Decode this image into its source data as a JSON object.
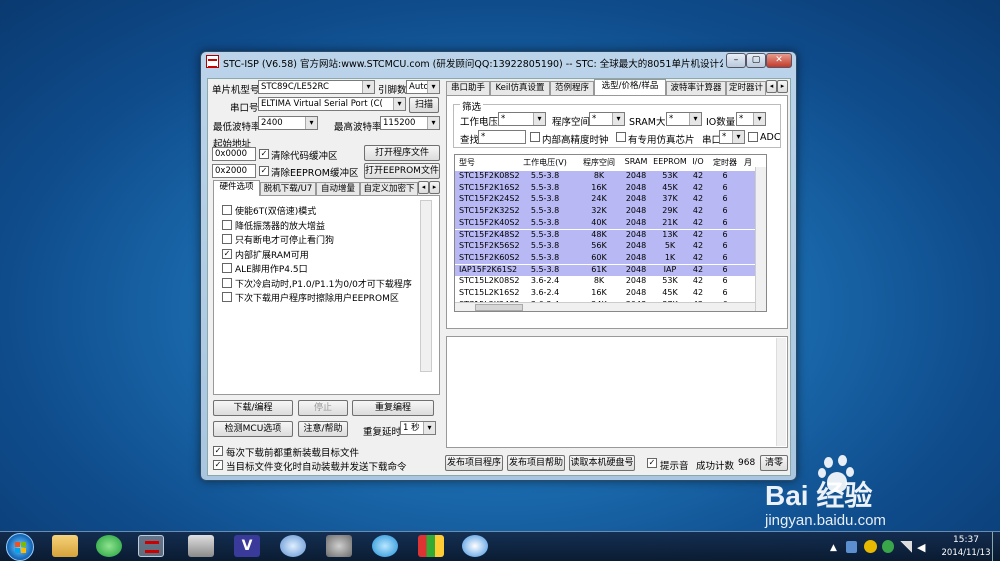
{
  "window": {
    "title": "STC-ISP (V6.58) 官方网站:www.STCMCU.com (研发顾问QQ:13922805190) -- STC: 全球最大的8051单片机设计公司 (我..."
  },
  "left": {
    "mcu_label": "单片机型号",
    "mcu_value": "STC89C/LE52RC",
    "pins_label": "引脚数",
    "pins_value": "Auto",
    "port_label": "串口号",
    "port_value": "ELTIMA Virtual Serial Port (C(",
    "scan": "扫描",
    "minbaud_label": "最低波特率",
    "minbaud_value": "2400",
    "maxbaud_label": "最高波特率",
    "maxbaud_value": "115200",
    "start_label": "起始地址",
    "addr1": "0x0000",
    "clear_code": "清除代码缓冲区",
    "open_prog": "打开程序文件",
    "addr2": "0x2000",
    "clear_eeprom": "清除EEPROM缓冲区",
    "open_eeprom": "打开EEPROM文件",
    "tabs": [
      "硬件选项",
      "脱机下载/U7",
      "自动增量",
      "自定义加密下"
    ],
    "options": [
      "使能6T(双倍速)模式",
      "降低振荡器的放大增益",
      "只有断电才可停止看门狗",
      "内部扩展RAM可用",
      "ALE脚用作P4.5口",
      "下次冷启动时,P1.0/P1.1为0/0才可下载程序",
      "下次下载用户程序时擦除用户EEPROM区"
    ],
    "download": "下载/编程",
    "stop": "停止",
    "reprog": "重复编程",
    "check": "检测MCU选项",
    "help": "注意/帮助",
    "delay_label": "重复延时",
    "delay_value": "1 秒",
    "reload": "每次下载前都重新装载目标文件",
    "autoload": "当目标文件变化时自动装载并发送下载命令"
  },
  "right": {
    "tabs": [
      "串口助手",
      "Keil仿真设置",
      "范例程序",
      "选型/价格/样品",
      "波特率计算器",
      "定时器计"
    ],
    "filter": "筛选",
    "voltage": "工作电压",
    "prog_space": "程序空间",
    "sram": "SRAM大小",
    "io": "IO数量",
    "search": "查找",
    "search_value": "*",
    "star": "*",
    "hp_clock": "内部高精度时钟",
    "sim": "有专用仿真芯片",
    "uart": "串口",
    "adc": "ADC",
    "headers": [
      "型号",
      "工作电压(V)",
      "程序空间",
      "SRAM",
      "EEPROM",
      "I/O",
      "定时器",
      "月"
    ],
    "rows": [
      [
        "STC15F2K08S2",
        "5.5-3.8",
        "8K",
        "2048",
        "53K",
        "42",
        "6"
      ],
      [
        "STC15F2K16S2",
        "5.5-3.8",
        "16K",
        "2048",
        "45K",
        "42",
        "6"
      ],
      [
        "STC15F2K24S2",
        "5.5-3.8",
        "24K",
        "2048",
        "37K",
        "42",
        "6"
      ],
      [
        "STC15F2K32S2",
        "5.5-3.8",
        "32K",
        "2048",
        "29K",
        "42",
        "6"
      ],
      [
        "STC15F2K40S2",
        "5.5-3.8",
        "40K",
        "2048",
        "21K",
        "42",
        "6"
      ],
      [
        "STC15F2K48S2",
        "5.5-3.8",
        "48K",
        "2048",
        "13K",
        "42",
        "6"
      ],
      [
        "STC15F2K56S2",
        "5.5-3.8",
        "56K",
        "2048",
        "5K",
        "42",
        "6"
      ],
      [
        "STC15F2K60S2",
        "5.5-3.8",
        "60K",
        "2048",
        "1K",
        "42",
        "6"
      ],
      [
        "IAP15F2K61S2",
        "5.5-3.8",
        "61K",
        "2048",
        "IAP",
        "42",
        "6"
      ],
      [
        "STC15L2K08S2",
        "3.6-2.4",
        "8K",
        "2048",
        "53K",
        "42",
        "6"
      ],
      [
        "STC15L2K16S2",
        "3.6-2.4",
        "16K",
        "2048",
        "45K",
        "42",
        "6"
      ],
      [
        "STC15L2K24S2",
        "3.6-2.4",
        "24K",
        "2048",
        "37K",
        "42",
        "6"
      ]
    ],
    "publish": "发布项目程序",
    "publish_help": "发布项目帮助",
    "read_hdd": "读取本机硬盘号",
    "beep": "提示音",
    "count_label": "成功计数",
    "count": "968",
    "clear": "清零"
  },
  "taskbar": {
    "time": "15:37",
    "date": "2014/11/13"
  },
  "watermark": {
    "brand": "Bai 经验",
    "url": "jingyan.baidu.com"
  }
}
